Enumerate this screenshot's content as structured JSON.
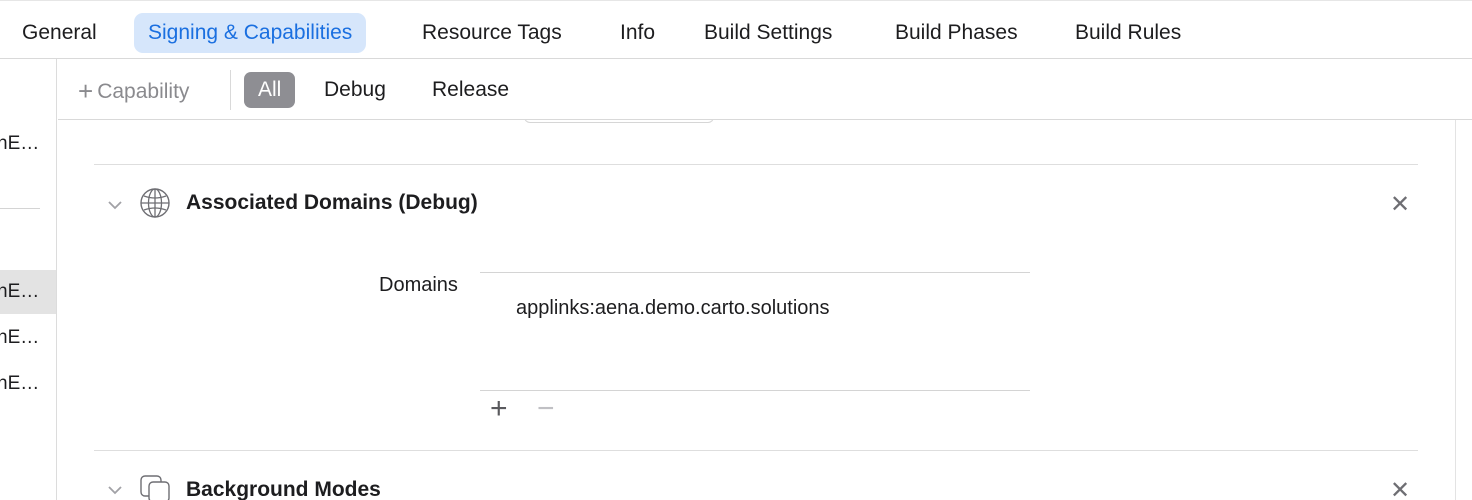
{
  "tabs": [
    {
      "label": "General",
      "active": false
    },
    {
      "label": "Signing & Capabilities",
      "active": true
    },
    {
      "label": "Resource Tags",
      "active": false
    },
    {
      "label": "Info",
      "active": false
    },
    {
      "label": "Build Settings",
      "active": false
    },
    {
      "label": "Build Phases",
      "active": false
    },
    {
      "label": "Build Rules",
      "active": false
    }
  ],
  "sidebar": {
    "items": [
      {
        "label": "nE…"
      },
      {
        "label": "nE…",
        "selected": true
      },
      {
        "label": "nE…"
      },
      {
        "label": "nE…"
      }
    ]
  },
  "filter": {
    "add_capability": "Capability",
    "configs": [
      "All",
      "Debug",
      "Release"
    ],
    "selected": "All"
  },
  "capabilities": [
    {
      "title": "Associated Domains (Debug)",
      "icon": "globe-icon",
      "field_label": "Domains",
      "domains": [
        "applinks:aena.demo.carto.solutions"
      ]
    },
    {
      "title": "Background Modes",
      "icon": "background-modes-icon"
    }
  ],
  "colors": {
    "accent": "#1a6fe0",
    "accent_bg": "#d6e6fb",
    "segment_selected": "#8e8e93",
    "sidebar_selected": "#e3e3e3"
  }
}
